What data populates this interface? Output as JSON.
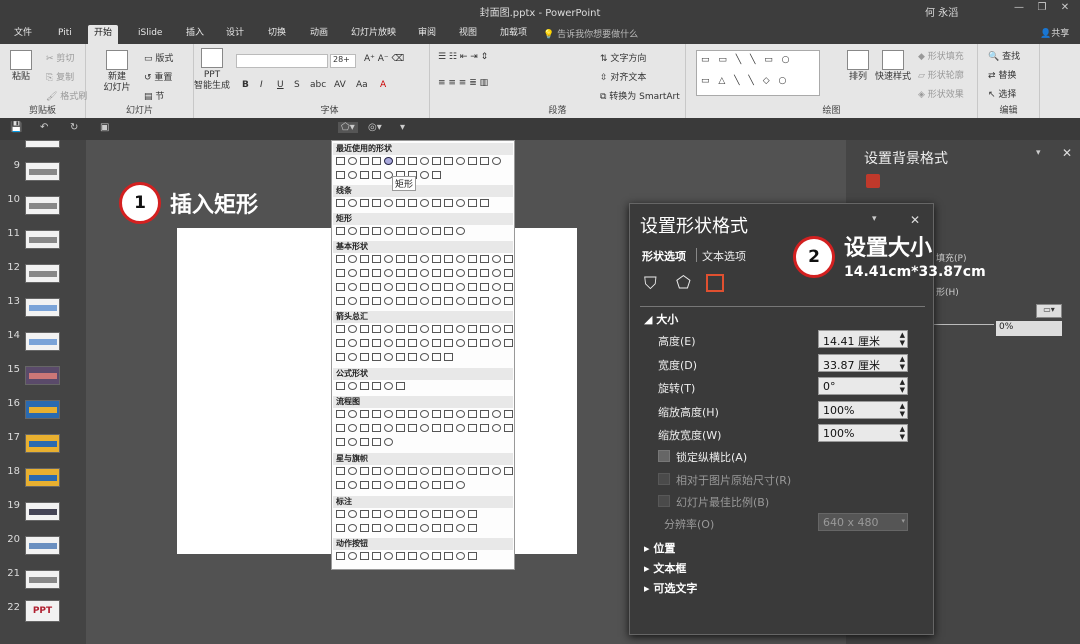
{
  "title_bar": {
    "document": "封面图.pptx  -  PowerPoint",
    "user": "何 永滔",
    "window_buttons": [
      "—",
      "❐",
      "✕"
    ]
  },
  "tabs": [
    "文件",
    "Piti",
    "开始",
    "iSlide",
    "插入",
    "设计",
    "切换",
    "动画",
    "幻灯片放映",
    "审阅",
    "视图",
    "加载项"
  ],
  "active_tab": "开始",
  "tell_me": "告诉我你想要做什么",
  "share": "共享",
  "ribbon": {
    "clipboard": {
      "label": "剪贴板",
      "paste": "粘贴",
      "cut": "剪切",
      "copy": "复制",
      "format_painter": "格式刷"
    },
    "slides": {
      "label": "幻灯片",
      "new_slide": "新建\n幻灯片",
      "layout": "版式",
      "reset": "重置",
      "section": "节"
    },
    "ppt_ai": {
      "label": "PPT\n智能生成"
    },
    "font": {
      "label": "字体",
      "size": "28+"
    },
    "paragraph": {
      "label": "段落",
      "text_direction": "文字方向",
      "align_text": "对齐文本",
      "smartart": "转换为 SmartArt"
    },
    "drawing": {
      "label": "绘图",
      "arrange": "排列",
      "quick_styles": "快速样式",
      "fill": "形状填充",
      "outline": "形状轮廓",
      "effects": "形状效果"
    },
    "editing": {
      "label": "编辑",
      "find": "查找",
      "replace": "替换",
      "select": "选择"
    }
  },
  "slides": [
    "9",
    "10",
    "11",
    "12",
    "13",
    "14",
    "15",
    "16",
    "17",
    "18",
    "19",
    "20",
    "21",
    "22"
  ],
  "slide_22_text": "PPT",
  "steps": [
    {
      "num": "1",
      "text": "插入矩形"
    },
    {
      "num": "2",
      "text": "设置大小",
      "sub": "14.41cm*33.87cm"
    }
  ],
  "gallery": {
    "sections": [
      "最近使用的形状",
      "线条",
      "矩形",
      "基本形状",
      "箭头总汇",
      "公式形状",
      "流程图",
      "星与旗帜",
      "标注",
      "动作按钮"
    ],
    "tooltip": "矩形"
  },
  "bg_panel": {
    "title": "设置背景格式",
    "partial_fill": "填充(P)",
    "partial_hide": "形(H)",
    "transparency": "0%"
  },
  "format_pane": {
    "title": "设置形状格式",
    "tab_shape": "形状选项",
    "tab_text": "文本选项",
    "size_section": "大小",
    "rows": [
      {
        "label": "高度(E)",
        "value": "14.41 厘米"
      },
      {
        "label": "宽度(D)",
        "value": "33.87 厘米"
      },
      {
        "label": "旋转(T)",
        "value": "0°"
      },
      {
        "label": "缩放高度(H)",
        "value": "100%"
      },
      {
        "label": "缩放宽度(W)",
        "value": "100%"
      }
    ],
    "lock_ratio": "锁定纵横比(A)",
    "relative_original": "相对于图片原始尺寸(R)",
    "best_scale": "幻灯片最佳比例(B)",
    "resolution_label": "分辨率(O)",
    "resolution_value": "640 x 480",
    "sections": [
      "位置",
      "文本框",
      "可选文字"
    ]
  }
}
